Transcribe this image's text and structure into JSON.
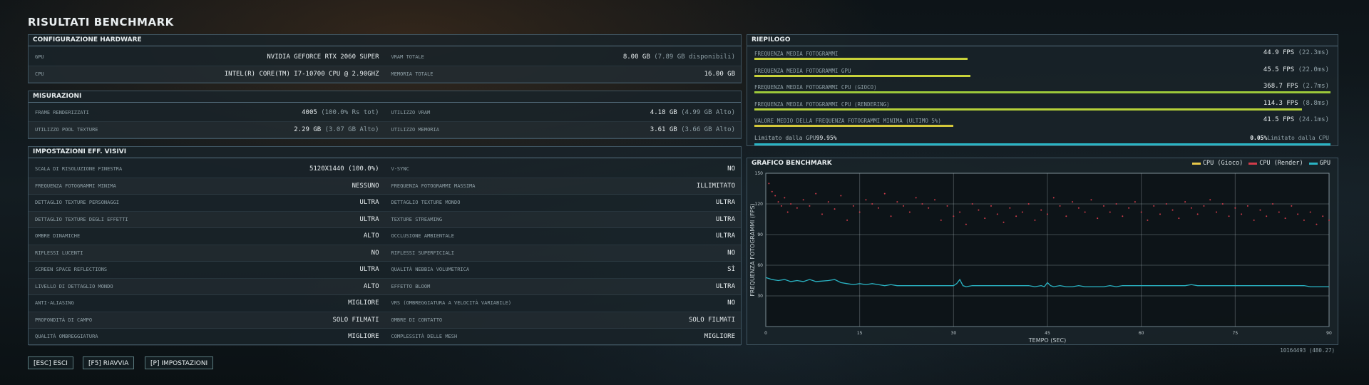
{
  "title": "RISULTATI BENCHMARK",
  "hardware": {
    "header": "CONFIGURAZIONE HARDWARE",
    "rows": [
      {
        "label": "GPU",
        "value": "NVIDIA GEFORCE RTX 2060 SUPER",
        "sub": ""
      },
      {
        "label": "VRAM TOTALE",
        "value": "8.00 GB",
        "sub": "(7.89 GB disponibili)"
      },
      {
        "label": "CPU",
        "value": "INTEL(R) CORE(TM) I7-10700 CPU @ 2.90GHZ",
        "sub": ""
      },
      {
        "label": "MEMORIA TOTALE",
        "value": "16.00 GB",
        "sub": ""
      }
    ]
  },
  "measurements": {
    "header": "MISURAZIONI",
    "rows": [
      {
        "label": "FRAME RENDERIZZATI",
        "value": "4005",
        "sub": "(100.0% Rs tot)"
      },
      {
        "label": "UTILIZZO VRAM",
        "value": "4.18 GB",
        "sub": "(4.99 GB Alto)"
      },
      {
        "label": "UTILIZZO POOL TEXTURE",
        "value": "2.29 GB",
        "sub": "(3.07 GB Alto)"
      },
      {
        "label": "UTILIZZO MEMORIA",
        "value": "3.61 GB",
        "sub": "(3.66 GB Alto)"
      }
    ]
  },
  "settings": {
    "header": "IMPOSTAZIONI EFF. VISIVI",
    "rows": [
      {
        "label": "SCALA DI RISOLUZIONE FINESTRA",
        "value": "5120X1440 (100.0%)"
      },
      {
        "label": "V-SYNC",
        "value": "NO"
      },
      {
        "label": "FREQUENZA FOTOGRAMMI MINIMA",
        "value": "NESSUNO"
      },
      {
        "label": "FREQUENZA FOTOGRAMMI MASSIMA",
        "value": "ILLIMITATO"
      },
      {
        "label": "DETTAGLIO TEXTURE PERSONAGGI",
        "value": "ULTRA"
      },
      {
        "label": "DETTAGLIO TEXTURE MONDO",
        "value": "ULTRA"
      },
      {
        "label": "DETTAGLIO TEXTURE DEGLI EFFETTI",
        "value": "ULTRA"
      },
      {
        "label": "TEXTURE STREAMING",
        "value": "ULTRA"
      },
      {
        "label": "OMBRE DINAMICHE",
        "value": "ALTO"
      },
      {
        "label": "OCCLUSIONE AMBIENTALE",
        "value": "ULTRA"
      },
      {
        "label": "RIFLESSI LUCENTI",
        "value": "NO"
      },
      {
        "label": "RIFLESSI SUPERFICIALI",
        "value": "NO"
      },
      {
        "label": "SCREEN SPACE REFLECTIONS",
        "value": "ULTRA"
      },
      {
        "label": "QUALITÀ NEBBIA VOLUMETRICA",
        "value": "SÌ"
      },
      {
        "label": "LIVELLO DI DETTAGLIO MONDO",
        "value": "ALTO"
      },
      {
        "label": "EFFETTO BLOOM",
        "value": "ULTRA"
      },
      {
        "label": "ANTI-ALIASING",
        "value": "MIGLIORE"
      },
      {
        "label": "VRS (OMBREGGIATURA A VELOCITÀ VARIABILE)",
        "value": "NO"
      },
      {
        "label": "PROFONDITÀ DI CAMPO",
        "value": "SOLO FILMATI"
      },
      {
        "label": "OMBRE DI CONTATTO",
        "value": "SOLO FILMATI"
      },
      {
        "label": "QUALITÀ OMBREGGIATURA",
        "value": "MIGLIORE"
      },
      {
        "label": "COMPLESSITÀ DELLE MESH",
        "value": "MIGLIORE"
      }
    ]
  },
  "summary": {
    "header": "RIEPILOGO",
    "rows": [
      {
        "label": "FREQUENZA MEDIA FOTOGRAMMI",
        "value": "44.9 FPS",
        "sub": "(22.3ms)",
        "bar": 0.37,
        "color": "#c8d23a"
      },
      {
        "label": "FREQUENZA MEDIA FOTOGRAMMI GPU",
        "value": "45.5 FPS",
        "sub": "(22.0ms)",
        "bar": 0.375,
        "color": "#c8d23a"
      },
      {
        "label": "FREQUENZA MEDIA FOTOGRAMMI CPU (GIOCO)",
        "value": "368.7 FPS",
        "sub": "(2.7ms)",
        "bar": 1.0,
        "color": "#9cc83a"
      },
      {
        "label": "FREQUENZA MEDIA FOTOGRAMMI CPU (RENDERING)",
        "value": "114.3 FPS",
        "sub": "(8.8ms)",
        "bar": 0.95,
        "color": "#b6d23a"
      },
      {
        "label": "VALORE MEDIO DELLA FREQUENZA FOTOGRAMMI MINIMA (ULTIMO 5%)",
        "value": "41.5 FPS",
        "sub": "(24.1ms)",
        "bar": 0.345,
        "color": "#d4c83a"
      }
    ],
    "cpu_limited": {
      "left_label": "Limitato dalla GPU",
      "left_value": "99.95%",
      "right_value": "0.05%",
      "right_label": "Limitato dalla CPU",
      "gpu_fraction": 0.9995,
      "color": "#2ab4c4"
    }
  },
  "chart_header": "GRAFICO BENCHMARK",
  "chart_data": {
    "type": "scatter",
    "title": "",
    "xlabel": "TEMPO (SEC)",
    "ylabel": "FREQUENZA FOTOGRAMMI (FPS)",
    "xlim": [
      0,
      90
    ],
    "ylim": [
      0,
      150
    ],
    "x_ticks": [
      0,
      15,
      30,
      45,
      60,
      75,
      90
    ],
    "y_ticks": [
      30,
      60,
      90,
      120,
      150
    ],
    "legend_position": "top-right",
    "series": [
      {
        "name": "CPU (Gioco)",
        "color": "#e8c84a",
        "points": []
      },
      {
        "name": "CPU (Render)",
        "color": "#d23c4a",
        "points": [
          [
            0.5,
            140
          ],
          [
            1,
            132
          ],
          [
            1.5,
            128
          ],
          [
            2,
            122
          ],
          [
            2.5,
            118
          ],
          [
            3,
            126
          ],
          [
            3.5,
            112
          ],
          [
            4,
            120
          ],
          [
            5,
            116
          ],
          [
            6,
            124
          ],
          [
            7,
            118
          ],
          [
            8,
            130
          ],
          [
            9,
            110
          ],
          [
            10,
            122
          ],
          [
            11,
            115
          ],
          [
            12,
            128
          ],
          [
            13,
            104
          ],
          [
            14,
            118
          ],
          [
            15,
            112
          ],
          [
            16,
            124
          ],
          [
            17,
            120
          ],
          [
            18,
            116
          ],
          [
            19,
            130
          ],
          [
            20,
            108
          ],
          [
            21,
            122
          ],
          [
            22,
            118
          ],
          [
            23,
            112
          ],
          [
            24,
            126
          ],
          [
            25,
            120
          ],
          [
            26,
            116
          ],
          [
            27,
            124
          ],
          [
            28,
            104
          ],
          [
            29,
            118
          ],
          [
            30,
            108
          ],
          [
            31,
            112
          ],
          [
            32,
            100
          ],
          [
            33,
            120
          ],
          [
            34,
            114
          ],
          [
            35,
            106
          ],
          [
            36,
            118
          ],
          [
            37,
            110
          ],
          [
            38,
            102
          ],
          [
            39,
            116
          ],
          [
            40,
            108
          ],
          [
            41,
            112
          ],
          [
            42,
            120
          ],
          [
            43,
            104
          ],
          [
            44,
            114
          ],
          [
            45,
            110
          ],
          [
            46,
            126
          ],
          [
            47,
            118
          ],
          [
            48,
            108
          ],
          [
            49,
            122
          ],
          [
            50,
            116
          ],
          [
            51,
            112
          ],
          [
            52,
            124
          ],
          [
            53,
            106
          ],
          [
            54,
            118
          ],
          [
            55,
            112
          ],
          [
            56,
            120
          ],
          [
            57,
            108
          ],
          [
            58,
            116
          ],
          [
            59,
            122
          ],
          [
            60,
            112
          ],
          [
            61,
            104
          ],
          [
            62,
            118
          ],
          [
            63,
            110
          ],
          [
            64,
            120
          ],
          [
            65,
            114
          ],
          [
            66,
            106
          ],
          [
            67,
            122
          ],
          [
            68,
            116
          ],
          [
            69,
            110
          ],
          [
            70,
            118
          ],
          [
            71,
            124
          ],
          [
            72,
            112
          ],
          [
            73,
            120
          ],
          [
            74,
            108
          ],
          [
            75,
            116
          ],
          [
            76,
            110
          ],
          [
            77,
            118
          ],
          [
            78,
            104
          ],
          [
            79,
            114
          ],
          [
            80,
            108
          ],
          [
            81,
            120
          ],
          [
            82,
            112
          ],
          [
            83,
            106
          ],
          [
            84,
            118
          ],
          [
            85,
            110
          ],
          [
            86,
            104
          ],
          [
            87,
            112
          ],
          [
            88,
            100
          ],
          [
            89,
            108
          ],
          [
            90,
            104
          ]
        ]
      },
      {
        "name": "GPU",
        "color": "#2ab4c4",
        "points": [
          [
            0,
            48
          ],
          [
            1,
            46
          ],
          [
            2,
            45
          ],
          [
            3,
            46
          ],
          [
            4,
            44
          ],
          [
            5,
            45
          ],
          [
            6,
            44
          ],
          [
            7,
            46
          ],
          [
            8,
            44
          ],
          [
            10,
            45
          ],
          [
            11,
            46
          ],
          [
            12,
            43
          ],
          [
            13,
            42
          ],
          [
            14,
            41
          ],
          [
            15,
            42
          ],
          [
            16,
            41
          ],
          [
            17,
            42
          ],
          [
            18,
            41
          ],
          [
            19,
            40
          ],
          [
            20,
            41
          ],
          [
            21,
            40
          ],
          [
            22,
            40
          ],
          [
            23,
            40
          ],
          [
            24,
            40
          ],
          [
            25,
            40
          ],
          [
            26,
            40
          ],
          [
            27,
            40
          ],
          [
            28,
            40
          ],
          [
            29,
            40
          ],
          [
            30,
            40
          ],
          [
            30.5,
            42
          ],
          [
            31,
            46
          ],
          [
            31.5,
            40
          ],
          [
            32,
            39
          ],
          [
            33,
            40
          ],
          [
            34,
            40
          ],
          [
            35,
            40
          ],
          [
            36,
            40
          ],
          [
            37,
            40
          ],
          [
            38,
            40
          ],
          [
            39,
            40
          ],
          [
            40,
            40
          ],
          [
            41,
            40
          ],
          [
            42,
            40
          ],
          [
            43,
            39
          ],
          [
            44,
            40
          ],
          [
            44.5,
            39
          ],
          [
            45,
            43
          ],
          [
            45.5,
            40
          ],
          [
            46,
            39
          ],
          [
            47,
            40
          ],
          [
            48,
            39
          ],
          [
            49,
            39
          ],
          [
            50,
            40
          ],
          [
            51,
            39
          ],
          [
            52,
            39
          ],
          [
            53,
            39
          ],
          [
            54,
            39
          ],
          [
            55,
            40
          ],
          [
            56,
            39
          ],
          [
            57,
            40
          ],
          [
            58,
            40
          ],
          [
            59,
            40
          ],
          [
            60,
            40
          ],
          [
            61,
            40
          ],
          [
            62,
            40
          ],
          [
            63,
            40
          ],
          [
            64,
            40
          ],
          [
            65,
            40
          ],
          [
            66,
            40
          ],
          [
            67,
            40
          ],
          [
            68,
            41
          ],
          [
            69,
            40
          ],
          [
            70,
            40
          ],
          [
            71,
            40
          ],
          [
            72,
            40
          ],
          [
            73,
            40
          ],
          [
            74,
            40
          ],
          [
            75,
            40
          ],
          [
            76,
            40
          ],
          [
            77,
            40
          ],
          [
            78,
            40
          ],
          [
            79,
            40
          ],
          [
            80,
            40
          ],
          [
            81,
            40
          ],
          [
            82,
            40
          ],
          [
            83,
            40
          ],
          [
            84,
            40
          ],
          [
            85,
            40
          ],
          [
            86,
            40
          ],
          [
            87,
            39
          ],
          [
            88,
            39
          ],
          [
            89,
            39
          ],
          [
            90,
            39
          ]
        ]
      }
    ]
  },
  "buttons": [
    {
      "label": "[ESC] ESCI"
    },
    {
      "label": "[F5] RIAVVIA"
    },
    {
      "label": "[P] IMPOSTAZIONI"
    }
  ],
  "version": "10164493 (480.27)",
  "colors": {
    "accent": "#2ab4c4",
    "panel_border": "#3f5460"
  }
}
